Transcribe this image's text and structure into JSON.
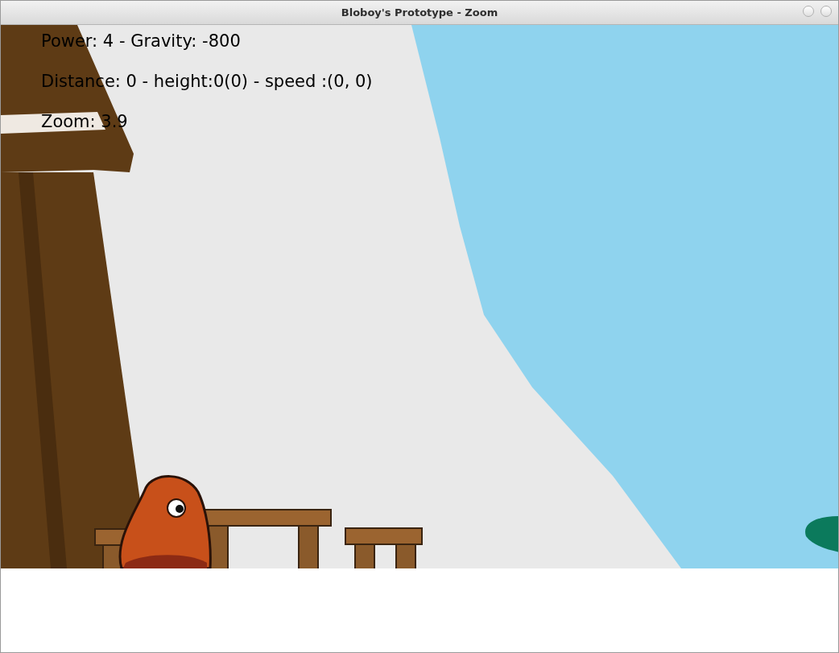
{
  "window": {
    "title": "Bloboy's Prototype - Zoom"
  },
  "hud": [
    "Power: 4 - Gravity: -800",
    "Distance: 0 - height:0(0) - speed :(0, 0)",
    "Zoom: 3.9"
  ]
}
